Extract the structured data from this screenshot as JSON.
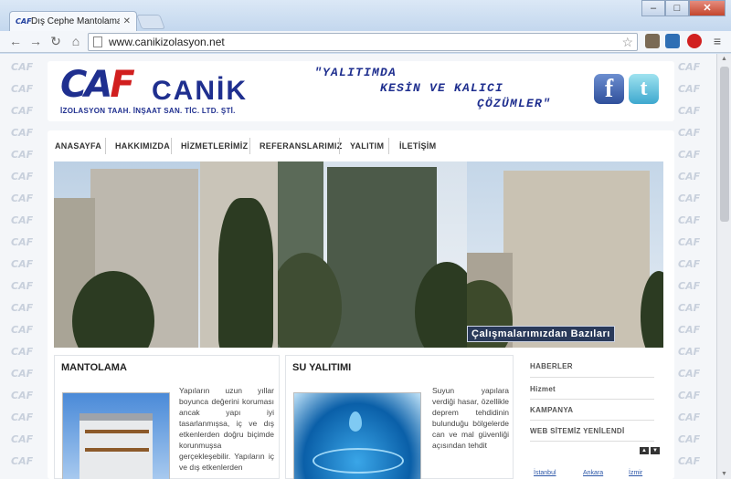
{
  "browser": {
    "tab_title": "Dış Cephe Mantolama, İsı",
    "tab_favicon": "CAF",
    "url": "www.canikizolasyon.net",
    "window_buttons": [
      "–",
      "□",
      "✕"
    ]
  },
  "site": {
    "logo_mark": "CA",
    "logo_mark_accent": "F",
    "logo_name": "CANİK",
    "logo_subtitle": "İZOLASYON TAAH. İNŞAAT SAN. TİC. LTD. ŞTİ.",
    "slogan_line1": "\"YALITIMDA",
    "slogan_line2": "KESİN VE KALICI",
    "slogan_line3": "ÇÖZÜMLER\"",
    "watermark": "CAF",
    "facebook_glyph": "f",
    "twitter_glyph": "t"
  },
  "nav": {
    "items": [
      "ANASAYFA",
      "HAKKIMIZDA",
      "HİZMETLERİMİZ",
      "REFERANSLARIMIZ",
      "YALITIM",
      "İLETİŞİM"
    ]
  },
  "hero": {
    "banner": "Çalışmalarımızdan Bazıları"
  },
  "cards": [
    {
      "title": "MANTOLAMA",
      "text": "Yapıların uzun yıllar boyunca değerini koruması ancak yapı iyi tasarlanmışsa, iç ve dış etkenlerden doğru biçimde korunmuşsa gerçekleşebilir. Yapıların iç ve dış etkenlerden"
    },
    {
      "title": "SU YALITIMI",
      "text": "Suyun yapılara verdiği hasar, özellikle deprem tehdidinin bulunduğu bölgelerde can ve mal güvenliği açısından tehdit"
    }
  ],
  "sidebar": {
    "headings": [
      "HABERLER",
      "Hizmet",
      "KAMPANYA",
      "WEB SİTEMİZ YENİLENDİ"
    ],
    "cities": [
      "İstanbul",
      "Ankara",
      "İzmir"
    ]
  }
}
